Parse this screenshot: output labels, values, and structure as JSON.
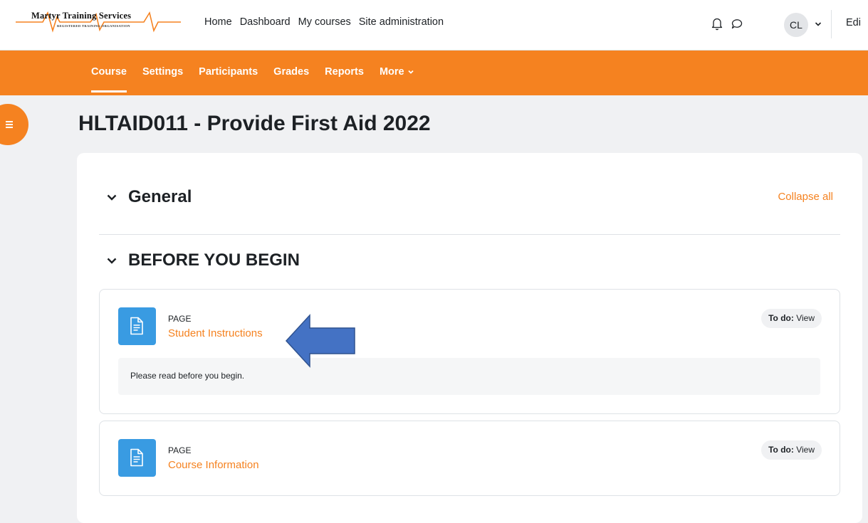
{
  "logo": {
    "title": "Martyr Training Services",
    "subtitle": "REGISTERED TRAINING ORGANISATION"
  },
  "primary_nav": [
    "Home",
    "Dashboard",
    "My courses",
    "Site administration"
  ],
  "user": {
    "initials": "CL",
    "edit_label": "Edi"
  },
  "secondary_nav": {
    "tabs": [
      "Course",
      "Settings",
      "Participants",
      "Grades",
      "Reports"
    ],
    "more_label": "More",
    "active": "Course"
  },
  "page_title": "HLTAID011 - Provide First Aid 2022",
  "sections": {
    "general_label": "General",
    "collapse_all_label": "Collapse all",
    "before_label": "BEFORE YOU BEGIN"
  },
  "activities": [
    {
      "type": "PAGE",
      "name": "Student Instructions",
      "todo_prefix": "To do:",
      "todo_value": "View",
      "description": "Please read before you begin."
    },
    {
      "type": "PAGE",
      "name": "Course Information",
      "todo_prefix": "To do:",
      "todo_value": "View"
    }
  ],
  "colors": {
    "accent": "#f58220",
    "icon_bg": "#399be2",
    "annotation_arrow": "#4472c4"
  }
}
